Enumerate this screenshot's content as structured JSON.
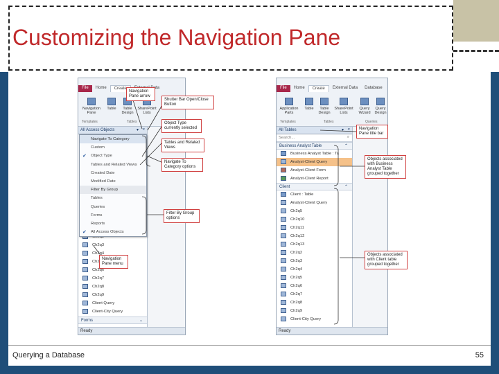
{
  "slide": {
    "title": "Customizing the Navigation Pane",
    "footer_left": "Querying a Database",
    "page_number": "55"
  },
  "left_window": {
    "tabs": [
      "File",
      "Home",
      "Create",
      "External Data"
    ],
    "ribbon_buttons": [
      "Navigation Pane",
      "Table",
      "Table Design",
      "SharePoint Lists"
    ],
    "group_labels": [
      "Templates",
      "Tables"
    ],
    "pane_header": "All Access Objects",
    "menu_items": [
      {
        "label": "Navigate To Category",
        "checked": false,
        "header": true
      },
      {
        "label": "Custom",
        "checked": false
      },
      {
        "label": "Object Type",
        "checked": true
      },
      {
        "label": "Tables and Related Views",
        "checked": false
      },
      {
        "label": "Created Date",
        "checked": false
      },
      {
        "label": "Modified Date",
        "checked": false
      },
      {
        "label": "Filter By Group",
        "checked": false,
        "header": true
      },
      {
        "label": "Tables",
        "checked": false
      },
      {
        "label": "Queries",
        "checked": false
      },
      {
        "label": "Forms",
        "checked": false
      },
      {
        "label": "Reports",
        "checked": false
      },
      {
        "label": "All Access Objects",
        "checked": true
      }
    ],
    "query_items": [
      "Ch2q2",
      "Ch2q3",
      "Ch2q4",
      "Ch2q5",
      "Ch2q6",
      "Ch2q7",
      "Ch2q8",
      "Ch2q9",
      "Client Query",
      "Client-City Query"
    ],
    "forms_group": "Forms",
    "status": "Ready"
  },
  "right_window": {
    "tabs": [
      "File",
      "Home",
      "Create",
      "External Data",
      "Database"
    ],
    "ribbon_buttons": [
      "Application Parts",
      "Table",
      "Table Design",
      "SharePoint Lists",
      "Query Wizard",
      "Query Design"
    ],
    "group_labels": [
      "Templates",
      "Tables",
      "Queries"
    ],
    "pane_header": "All Tables",
    "search_placeholder": "Search...",
    "group1_name": "Business Analyst Table",
    "group1_items": [
      {
        "label": "Business Analyst Table : Ta",
        "type": "table"
      },
      {
        "label": "Analyst-Client Query",
        "type": "query",
        "highlight": true
      },
      {
        "label": "Analyst-Client Form",
        "type": "form"
      },
      {
        "label": "Analyst-Client Report",
        "type": "report"
      }
    ],
    "group2_name": "Client",
    "group2_items": [
      {
        "label": "Client : Table",
        "type": "table"
      },
      {
        "label": "Analyst-Client Query",
        "type": "query"
      },
      {
        "label": "Ch2q5",
        "type": "query"
      },
      {
        "label": "Ch2q10",
        "type": "query"
      },
      {
        "label": "Ch2q11",
        "type": "query"
      },
      {
        "label": "Ch2q12",
        "type": "query"
      },
      {
        "label": "Ch2q13",
        "type": "query"
      },
      {
        "label": "Ch2q2",
        "type": "query"
      },
      {
        "label": "Ch2q3",
        "type": "query"
      },
      {
        "label": "Ch2q4",
        "type": "query"
      },
      {
        "label": "Ch2q5",
        "type": "query"
      },
      {
        "label": "Ch2q6",
        "type": "query"
      },
      {
        "label": "Ch2q7",
        "type": "query"
      },
      {
        "label": "Ch2q8",
        "type": "query"
      },
      {
        "label": "Ch2q9",
        "type": "query"
      },
      {
        "label": "Client-City Query",
        "type": "query"
      }
    ],
    "status": "Ready"
  },
  "callouts": {
    "nav_pane_arrow": "Navigation Pane arrow",
    "shutter_bar": "Shutter Bar Open/Close Button",
    "object_type": "Object Type currently selected",
    "tables_related": "Tables and Related Views",
    "navigate_category": "Navigate To Category options",
    "filter_group": "Filter By Group options",
    "nav_pane_menu": "Navigation Pane menu",
    "nav_title_bar": "Navigation Pane title bar",
    "objects_business": "Objects associated with Business Analyst Table grouped together",
    "objects_client": "Objects associated with Client table grouped together"
  },
  "colors": {
    "title": "#c0282a",
    "slide_frame": "#1f4e79",
    "accent_beige": "#c8c2a6",
    "file_tab": "#a8274a",
    "highlight_item": "#f5c189",
    "callout_border": "#d04040"
  }
}
